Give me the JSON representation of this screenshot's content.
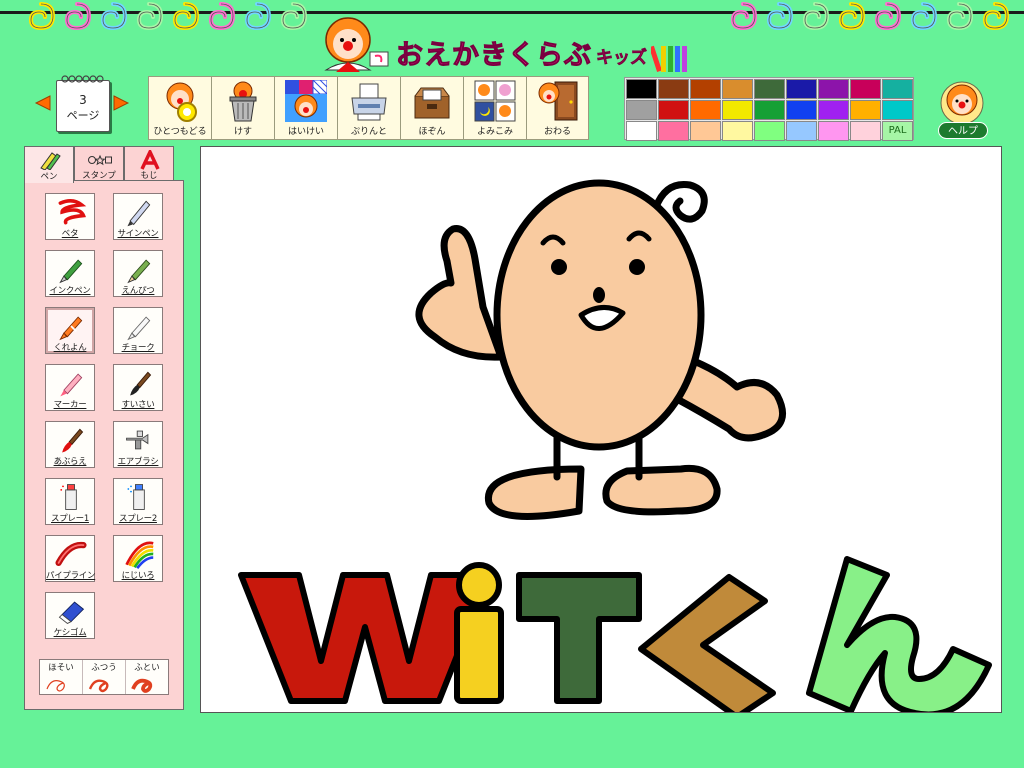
{
  "app": {
    "title": "おえかきくらぶ",
    "edition": "キッズ"
  },
  "pager": {
    "page_number": "3",
    "page_label": "ページ"
  },
  "toolbar": [
    {
      "id": "undo",
      "label": "ひとつもどる",
      "icon": "clown-undo-icon"
    },
    {
      "id": "erase",
      "label": "けす",
      "icon": "trash-can-icon"
    },
    {
      "id": "background",
      "label": "はいけい",
      "icon": "background-pattern-icon"
    },
    {
      "id": "print",
      "label": "ぷりんと",
      "icon": "printer-icon"
    },
    {
      "id": "save",
      "label": "ほぞん",
      "icon": "save-box-icon"
    },
    {
      "id": "load",
      "label": "よみこみ",
      "icon": "load-pictures-icon"
    },
    {
      "id": "quit",
      "label": "おわる",
      "icon": "exit-door-icon"
    }
  ],
  "palette": {
    "colors": [
      "#000000",
      "#8a3b12",
      "#b34000",
      "#d98d2d",
      "#3e6a3a",
      "#1a1aa8",
      "#8c14aa",
      "#c8005a",
      "#15b0a0",
      "#a0a0a0",
      "#d01010",
      "#ff6a00",
      "#f2e800",
      "#16a035",
      "#1040f0",
      "#a020f0",
      "#ffb000",
      "#00c8c8",
      "#ffffff",
      "#ff6fa0",
      "#ffc896",
      "#fff8a0",
      "#80ff80",
      "#96c8ff",
      "#ff96f0",
      "#ffd2dc"
    ],
    "pal_label": "PAL"
  },
  "help": {
    "label": "ヘルプ",
    "icon": "clown-help-icon"
  },
  "tabs": [
    {
      "id": "pen",
      "label": "ペン",
      "icon": "pen-tab-icon",
      "active": true
    },
    {
      "id": "stamp",
      "label": "スタンプ",
      "icon": "shape-stamp-icon",
      "active": false
    },
    {
      "id": "text",
      "label": "もじ",
      "icon": "letter-a-icon",
      "active": false
    }
  ],
  "pen_tools": [
    {
      "id": "beta",
      "label": "ベタ",
      "icon": "paint-scribble-icon"
    },
    {
      "id": "sign-pen",
      "label": "サインペン",
      "icon": "sign-pen-icon"
    },
    {
      "id": "ink-pen",
      "label": "インクペン",
      "icon": "fountain-pen-icon"
    },
    {
      "id": "pencil",
      "label": "えんぴつ",
      "icon": "pencil-icon"
    },
    {
      "id": "crayon",
      "label": "くれよん",
      "icon": "crayon-icon",
      "selected": true
    },
    {
      "id": "chalk",
      "label": "チョーク",
      "icon": "chalk-icon"
    },
    {
      "id": "marker",
      "label": "マーカー",
      "icon": "marker-icon"
    },
    {
      "id": "watercolor",
      "label": "すいさい",
      "icon": "watercolor-brush-icon"
    },
    {
      "id": "oil",
      "label": "あぶらえ",
      "icon": "oil-paint-brush-icon"
    },
    {
      "id": "airbrush",
      "label": "エアブラシ",
      "icon": "airbrush-icon"
    },
    {
      "id": "spray1",
      "label": "スプレー1",
      "icon": "spray-can-1-icon"
    },
    {
      "id": "spray2",
      "label": "スプレー2",
      "icon": "spray-can-2-icon"
    },
    {
      "id": "pipeline",
      "label": "パイプライン",
      "icon": "pipe-line-icon"
    },
    {
      "id": "rainbow",
      "label": "にじいろ",
      "icon": "rainbow-icon"
    },
    {
      "id": "eraser",
      "label": "ケシゴム",
      "icon": "eraser-icon"
    }
  ],
  "widths": [
    {
      "id": "thin",
      "label": "ほそい",
      "icon": "thin-stroke-icon"
    },
    {
      "id": "normal",
      "label": "ふつう",
      "icon": "normal-stroke-icon"
    },
    {
      "id": "thick",
      "label": "ふとい",
      "icon": "thick-stroke-icon"
    }
  ],
  "canvas": {
    "drawing_text": "WiTくん",
    "colors": {
      "body": "#f9cba0",
      "w": "#c8180c",
      "i": "#f5d020",
      "t": "#3e6a3a",
      "ku": "#c08a3a",
      "n": "#88f088"
    }
  }
}
